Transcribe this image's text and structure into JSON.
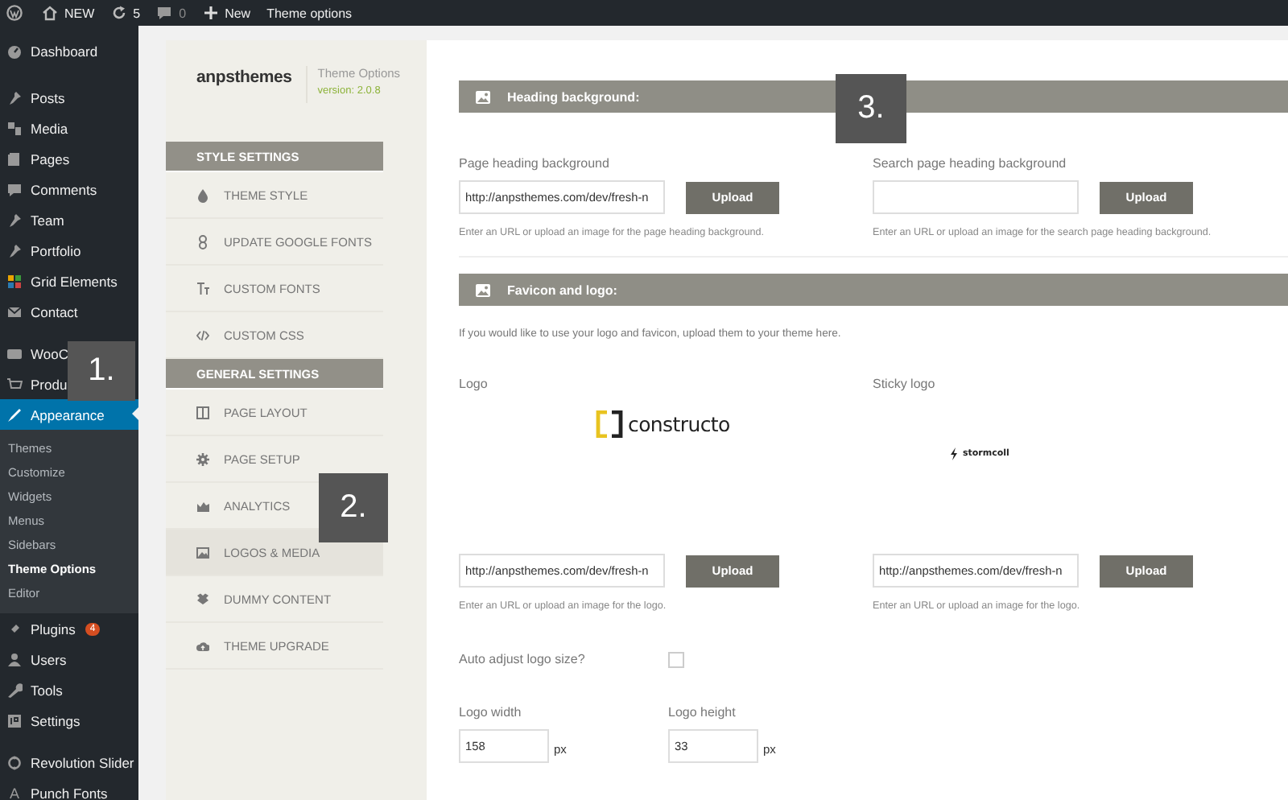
{
  "admin_bar": {
    "items": [
      {
        "kind": "home",
        "label": "NEW"
      },
      {
        "kind": "updates",
        "label": "5"
      },
      {
        "kind": "comments",
        "label": "0"
      },
      {
        "kind": "new",
        "label": "New"
      },
      {
        "kind": "plain",
        "label": "Theme options"
      }
    ]
  },
  "admin_menu": {
    "groups": [
      [
        {
          "label": "Dashboard",
          "selected": false
        }
      ],
      [
        {
          "label": "Posts",
          "selected": false
        },
        {
          "label": "Media",
          "selected": false
        },
        {
          "label": "Pages",
          "selected": false
        },
        {
          "label": "Comments",
          "selected": false
        },
        {
          "label": "Team",
          "selected": false
        },
        {
          "label": "Portfolio",
          "selected": false
        },
        {
          "label": "Grid Elements",
          "selected": false
        },
        {
          "label": "Contact",
          "selected": false
        }
      ],
      [
        {
          "label": "WooC",
          "selected": false
        },
        {
          "label": "Produ",
          "selected": false
        },
        {
          "label": "Appearance",
          "selected": true,
          "children": [
            {
              "label": "Themes",
              "selected": false
            },
            {
              "label": "Customize",
              "selected": false
            },
            {
              "label": "Widgets",
              "selected": false
            },
            {
              "label": "Menus",
              "selected": false
            },
            {
              "label": "Sidebars",
              "selected": false
            },
            {
              "label": "Theme Options",
              "selected": true
            },
            {
              "label": "Editor",
              "selected": false
            }
          ]
        },
        {
          "label": "Plugins",
          "selected": false,
          "badge": "4"
        },
        {
          "label": "Users",
          "selected": false
        },
        {
          "label": "Tools",
          "selected": false
        },
        {
          "label": "Settings",
          "selected": false
        }
      ],
      [
        {
          "label": "Revolution Slider",
          "selected": false
        },
        {
          "label": "Punch Fonts",
          "selected": false,
          "glyph": "A"
        }
      ]
    ]
  },
  "options_nav": {
    "brand": "anpsthemes",
    "title": "Theme Options",
    "version": "version: 2.0.8",
    "sections": [
      {
        "title": "STYLE SETTINGS",
        "items": [
          {
            "label": "THEME STYLE",
            "selected": false
          },
          {
            "label": "UPDATE GOOGLE FONTS",
            "selected": false
          },
          {
            "label": "CUSTOM FONTS",
            "selected": false
          },
          {
            "label": "CUSTOM CSS",
            "selected": false
          }
        ]
      },
      {
        "title": "GENERAL SETTINGS",
        "items": [
          {
            "label": "PAGE LAYOUT",
            "selected": false
          },
          {
            "label": "PAGE SETUP",
            "selected": false
          },
          {
            "label": "ANALYTICS",
            "selected": false
          },
          {
            "label": "LOGOS & MEDIA",
            "selected": true
          },
          {
            "label": "DUMMY CONTENT",
            "selected": false
          },
          {
            "label": "THEME UPGRADE",
            "selected": false
          }
        ]
      }
    ]
  },
  "main": {
    "sections": [
      {
        "title": "Heading background:",
        "rows": [
          {
            "kind": "uploads",
            "fields": [
              {
                "label": "Page heading background",
                "value": "http://anpsthemes.com/dev/fresh-n",
                "button": "Upload",
                "help": "Enter an URL or upload an image for the page heading background."
              },
              {
                "label": "Search page heading background",
                "button": "Upload",
                "help": "Enter an URL or upload an image for the search page heading background."
              }
            ]
          }
        ]
      },
      {
        "title": "Favicon and logo:",
        "rows": [
          {
            "kind": "text",
            "text": "If you would like to use your logo and favicon, upload them to your theme here."
          },
          {
            "kind": "uploads",
            "fields": [
              {
                "label": "Logo",
                "preview": {
                  "kind": "bracket",
                  "text": "constructo"
                },
                "value": "http://anpsthemes.com/dev/fresh-n",
                "button": "Upload",
                "help": "Enter an URL or upload an image for the logo."
              },
              {
                "label": "Sticky logo",
                "preview": {
                  "kind": "bolt",
                  "text": "stormcoll"
                },
                "value": "http://anpsthemes.com/dev/fresh-n",
                "button": "Upload",
                "help": "Enter an URL or upload an image for the logo."
              }
            ]
          },
          {
            "kind": "checkbox",
            "label": "Auto adjust logo size?",
            "checked": false
          },
          {
            "kind": "numbers",
            "fields": [
              {
                "label": "Logo width",
                "value": "158",
                "unit": "px"
              },
              {
                "label": "Logo height",
                "value": "33",
                "unit": "px"
              }
            ]
          }
        ]
      }
    ]
  },
  "markers": [
    {
      "label": "1."
    },
    {
      "label": "2."
    },
    {
      "label": "3."
    }
  ]
}
